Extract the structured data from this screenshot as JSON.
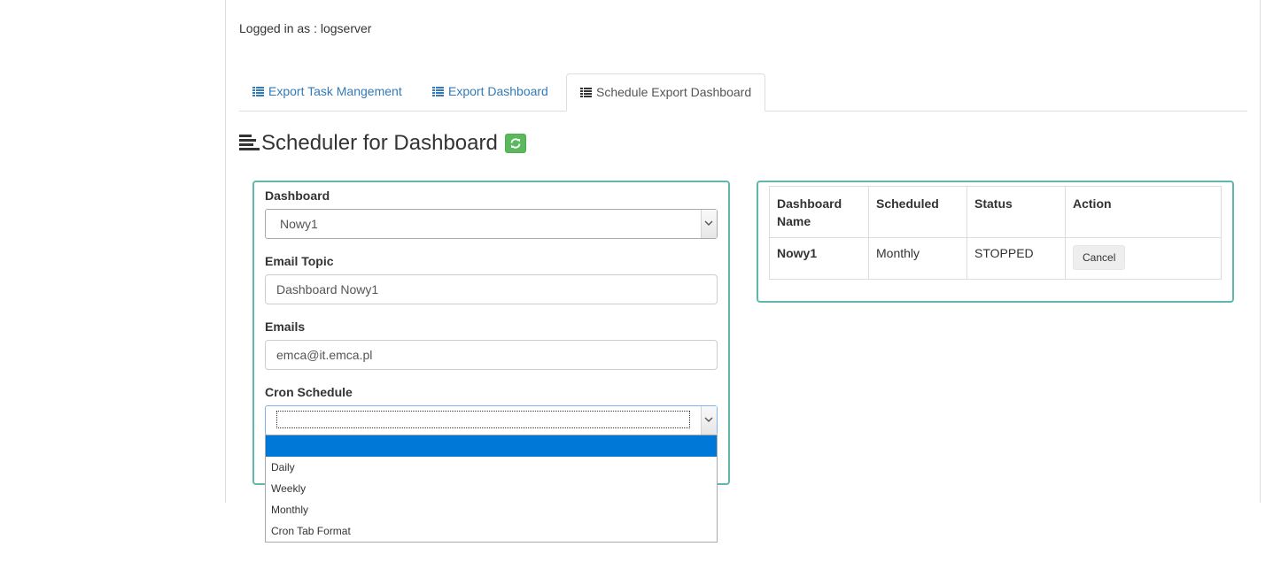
{
  "header": {
    "login_label": "Logged in as : ",
    "username": "logserver"
  },
  "tabs": [
    {
      "label": "Export Task Mangement",
      "icon": "list-icon",
      "active": false
    },
    {
      "label": "Export Dashboard",
      "icon": "list-icon",
      "active": false
    },
    {
      "label": "Schedule Export Dashboard",
      "icon": "list-icon",
      "active": true
    }
  ],
  "page": {
    "title": "Scheduler for Dashboard",
    "title_icon": "align-left-icon",
    "refresh_icon": "refresh-icon"
  },
  "form": {
    "dashboard_label": "Dashboard",
    "dashboard_value": "Nowy1",
    "email_topic_label": "Email Topic",
    "email_topic_value": "Dashboard Nowy1",
    "emails_label": "Emails",
    "emails_value": "emca@it.emca.pl",
    "cron_label": "Cron Schedule",
    "cron_value": "",
    "cron_options": [
      "",
      "Daily",
      "Weekly",
      "Monthly",
      "Cron Tab Format"
    ]
  },
  "table": {
    "headers": [
      "Dashboard Name",
      "Scheduled",
      "Status",
      "Action"
    ],
    "rows": [
      {
        "name": "Nowy1",
        "scheduled": "Monthly",
        "status": "STOPPED",
        "action": "Cancel"
      }
    ]
  },
  "colors": {
    "accent_border": "#5fb8ad",
    "link": "#337ab7",
    "refresh_button": "#5cb85c",
    "dropdown_highlight": "#0078d7"
  }
}
